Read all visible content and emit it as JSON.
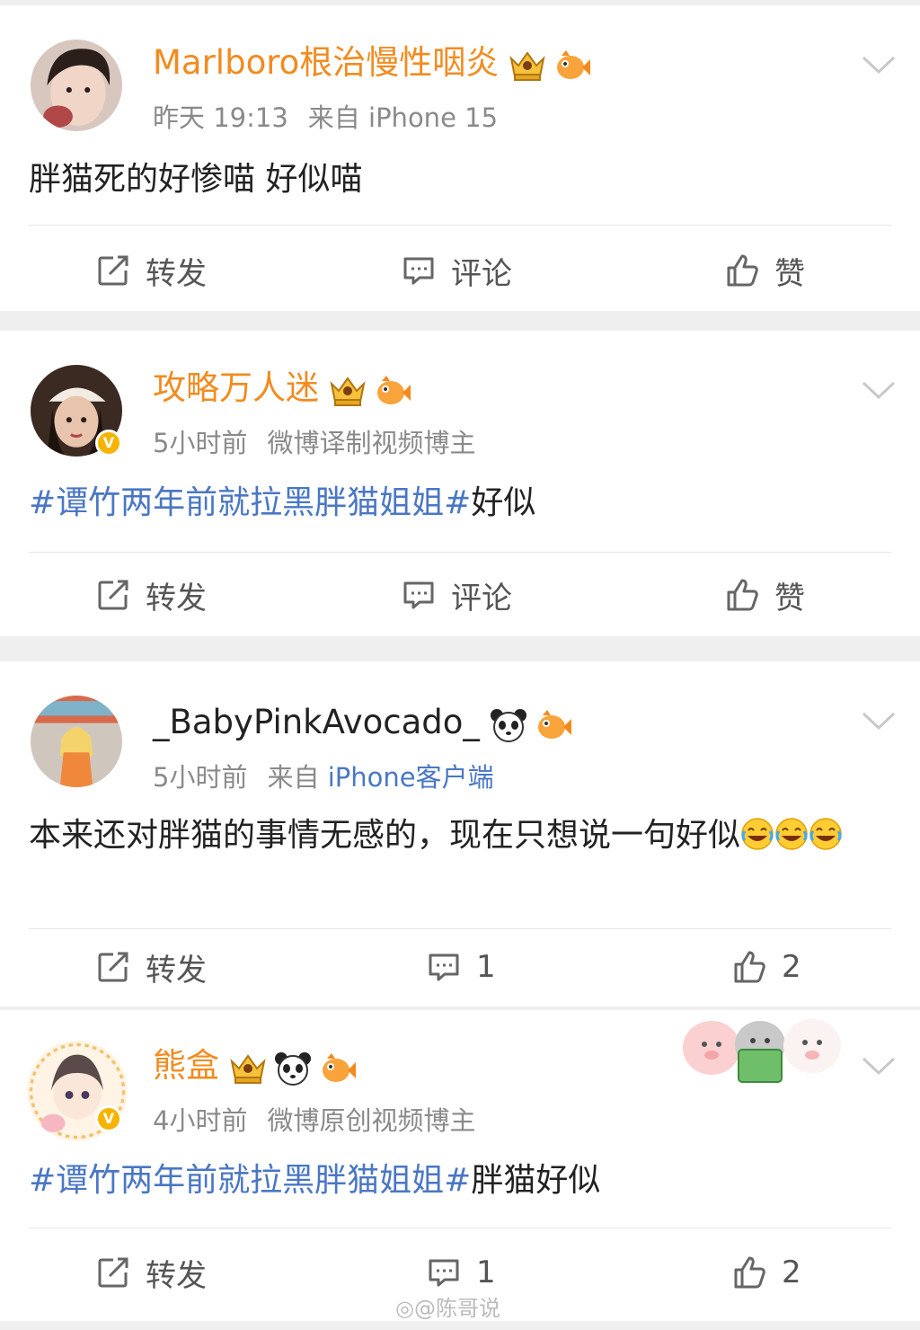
{
  "comments": [
    {
      "username": "Marlboro根治慢性咽炎",
      "time": "昨天 19:13",
      "source": "来自 iPhone 15",
      "text": "胖猫死的好惨喵 好似喵",
      "verified": false,
      "badges": [
        "crown-badge-icon",
        "fish-badge-icon"
      ],
      "actions": {
        "repost": "转发",
        "comment": "评论",
        "like": "赞"
      }
    },
    {
      "username": "攻略万人迷",
      "time": "5小时前",
      "source": "微博译制视频博主",
      "hashtag": "#谭竹两年前就拉黑胖猫姐姐#",
      "text": "好似",
      "verified": true,
      "badges": [
        "crown-badge-icon",
        "fish-badge-icon"
      ],
      "actions": {
        "repost": "转发",
        "comment": "评论",
        "like": "赞"
      }
    },
    {
      "username": "_BabyPinkAvocado_",
      "time": "5小时前",
      "source_prefix": "来自",
      "source_link": "iPhone客户端",
      "text": "本来还对胖猫的事情无感的，现在只想说一句好似",
      "emoji": [
        "laugh-cry-emoji",
        "laugh-cry-emoji",
        "laugh-cry-emoji"
      ],
      "verified": false,
      "badges": [
        "panda-badge-icon",
        "fish-badge-icon"
      ],
      "actions": {
        "repost": "转发",
        "comment": "1",
        "like": "2"
      }
    },
    {
      "username": "熊盒",
      "time": "4小时前",
      "source": "微博原创视频博主",
      "hashtag": "#谭竹两年前就拉黑胖猫姐姐#",
      "text": "胖猫好似",
      "verified": true,
      "badges": [
        "crown-badge-icon",
        "panda-badge-icon",
        "fish-badge-icon"
      ],
      "actions": {
        "repost": "转发",
        "comment": "1",
        "like": "2"
      }
    }
  ],
  "verified_mark": "V",
  "watermark": "@陈哥说",
  "colors": {
    "name_orange": "#f28b1f",
    "link_blue": "#4a77c4",
    "meta_gray": "#8a8a8a",
    "background": "#efefef"
  }
}
